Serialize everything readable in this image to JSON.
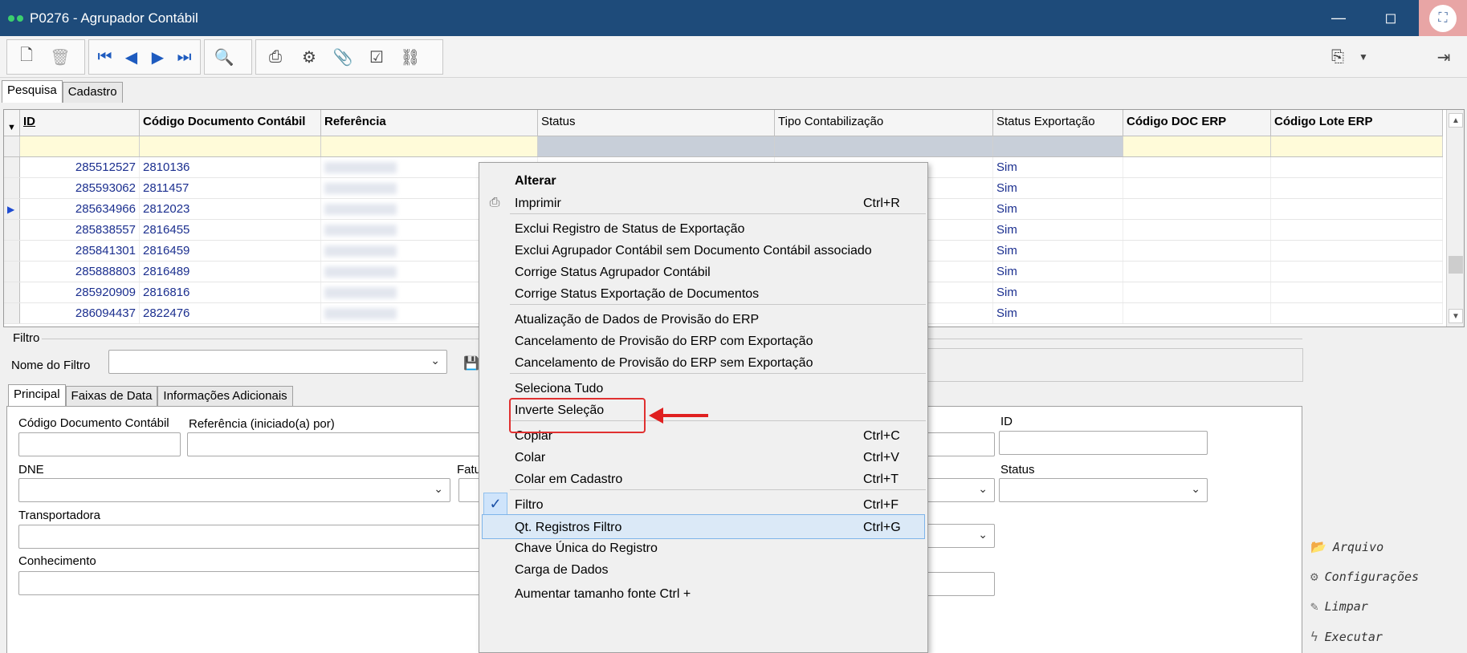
{
  "window": {
    "title": "P0276 - Agrupador Contábil",
    "min_glyph": "—",
    "max_glyph": "◻",
    "close_glyph": "⛶"
  },
  "toolbar": {
    "icons": [
      "new-document-icon",
      "delete-icon",
      "first-record-icon",
      "prev-record-icon",
      "next-record-icon",
      "last-record-icon",
      "search-record-icon",
      "print-icon",
      "settings-icon",
      "attach-icon",
      "confirm-icon",
      "link-icon",
      "export-icon",
      "dropdown-icon",
      "exit-icon"
    ]
  },
  "tabs": [
    "Pesquisa",
    "Cadastro"
  ],
  "grid": {
    "columns": [
      "ID",
      "Código Documento Contábil",
      "Referência",
      "Status",
      "Tipo Contabilização",
      "Status Exportação",
      "Código DOC ERP",
      "Código Lote ERP"
    ],
    "rows": [
      {
        "id": "285512527",
        "codigo": "2810136",
        "status_exp": "Sim"
      },
      {
        "id": "285593062",
        "codigo": "2811457",
        "status_exp": "Sim"
      },
      {
        "id": "285634966",
        "codigo": "2812023",
        "status_exp": "Sim"
      },
      {
        "id": "285838557",
        "codigo": "2816455",
        "status_exp": "Sim"
      },
      {
        "id": "285841301",
        "codigo": "2816459",
        "status_exp": "Sim"
      },
      {
        "id": "285888803",
        "codigo": "2816489",
        "status_exp": "Sim"
      },
      {
        "id": "285920909",
        "codigo": "2816816",
        "status_exp": "Sim"
      },
      {
        "id": "286094437",
        "codigo": "2822476",
        "status_exp": "Sim"
      }
    ],
    "current_row_marker": "▶",
    "filter_marker": "▼"
  },
  "filtro": {
    "label": "Filtro",
    "nome_label": "Nome do Filtro",
    "nome_value": ""
  },
  "subtabs": [
    "Principal",
    "Faixas de Data",
    "Informações Adicionais"
  ],
  "form": {
    "codigo_doc": "Código Documento Contábil",
    "referencia": "Referência (iniciado(a) por)",
    "id": "ID",
    "dne": "DNE",
    "fatu": "Fatu",
    "status": "Status",
    "transportadora": "Transportadora",
    "conhecimento": "Conhecimento"
  },
  "side_actions": [
    "Arquivo",
    "Configurações",
    "Limpar",
    "Executar"
  ],
  "context_menu": {
    "items": [
      {
        "label": "Alterar",
        "shortcut": ""
      },
      {
        "label": "Imprimir",
        "shortcut": "Ctrl+R"
      },
      {
        "label": "Exclui Registro de Status de Exportação",
        "shortcut": ""
      },
      {
        "label": "Exclui Agrupador Contábil sem Documento Contábil associado",
        "shortcut": ""
      },
      {
        "label": "Corrige Status Agrupador Contábil",
        "shortcut": ""
      },
      {
        "label": "Corrige Status Exportação de Documentos",
        "shortcut": ""
      },
      {
        "label": "Atualização de Dados de Provisão do ERP",
        "shortcut": ""
      },
      {
        "label": "Cancelamento de Provisão do ERP com Exportação",
        "shortcut": ""
      },
      {
        "label": "Cancelamento de Provisão do ERP sem Exportação",
        "shortcut": ""
      },
      {
        "label": "Seleciona Tudo",
        "shortcut": ""
      },
      {
        "label": "Inverte Seleção",
        "shortcut": ""
      },
      {
        "label": "Copiar",
        "shortcut": "Ctrl+C"
      },
      {
        "label": "Colar",
        "shortcut": "Ctrl+V"
      },
      {
        "label": "Colar em Cadastro",
        "shortcut": "Ctrl+T"
      },
      {
        "label": "Filtro",
        "shortcut": "Ctrl+F"
      },
      {
        "label": "Qt. Registros Filtro",
        "shortcut": "Ctrl+G"
      },
      {
        "label": "Chave Única do Registro",
        "shortcut": ""
      },
      {
        "label": "Carga de Dados",
        "shortcut": ""
      },
      {
        "label": "Aumentar tamanho fonte  Ctrl +",
        "shortcut": ""
      }
    ],
    "highlighted": "Qt. Registros Filtro",
    "checked": "Filtro"
  },
  "colors": {
    "titlebar": "#1e4b7a",
    "annotation": "#e03030",
    "link_text": "#1b2f8f"
  }
}
